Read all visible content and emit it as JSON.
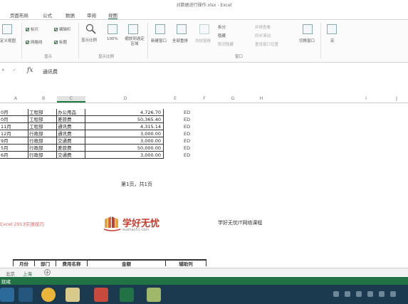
{
  "window": {
    "title": "对数据进行操作.xlsx - Excel"
  },
  "tabs": [
    "页面布局",
    "公式",
    "数据",
    "审阅",
    "视图"
  ],
  "ribbon": {
    "workbook_views": {
      "label": "定义视图"
    },
    "show": {
      "ruler": "标尺",
      "formula_bar": "编辑栏",
      "gridlines": "网格线",
      "headings": "标题",
      "group_label": "显示"
    },
    "zoom": {
      "zoom": "显示比例",
      "hundred": "100%",
      "to_selection": "缩放到选定区域",
      "group_label": "显示比例"
    },
    "window": {
      "new_window": "新建窗口",
      "arrange_all": "全部重排",
      "freeze_panes": "冻结窗格",
      "split": "拆分",
      "hide": "隐藏",
      "unhide": "取消隐藏",
      "side_by_side": "并排查看",
      "sync_scroll": "同步滚动",
      "reset_position": "重设窗口位置",
      "switch_windows": "切换窗口",
      "macros": "宏",
      "group_label": "窗口"
    }
  },
  "formula_bar": {
    "content": "通讯费"
  },
  "columns": [
    "A",
    "B",
    "C",
    "D",
    "E",
    "F",
    "G",
    "H",
    "I",
    "J"
  ],
  "rows": [
    {
      "month": "0月",
      "dept": "工程部",
      "item": "办公用品",
      "amount": "4,726.70",
      "sig": "ED"
    },
    {
      "month": "0月",
      "dept": "工程部",
      "item": "差旅费",
      "amount": "50,365.40",
      "sig": "ED"
    },
    {
      "month": "11月",
      "dept": "工程部",
      "item": "通讯费",
      "amount": "4,315.14",
      "sig": "ED"
    },
    {
      "month": "12月",
      "dept": "行政部",
      "item": "通讯费",
      "amount": "3,000.00",
      "sig": "ED"
    },
    {
      "month": "9月",
      "dept": "行政部",
      "item": "交通费",
      "amount": "3,000.00",
      "sig": "ED"
    },
    {
      "month": "5月",
      "dept": "行政部",
      "item": "差旅费",
      "amount": "50,000.00",
      "sig": "ED"
    },
    {
      "month": "6月",
      "dept": "行政部",
      "item": "交通费",
      "amount": "3,000.00",
      "sig": "ED"
    }
  ],
  "page_footer": "第1页，共1页",
  "watermark": {
    "left": "Excel 2013实操技巧",
    "logo_name": "学好无忧",
    "logo_sub": "xuehao51.com",
    "right": "学好无忧IT网络课程"
  },
  "bottom_header": [
    "月份",
    "部门",
    "费用名称",
    "金额",
    "辅助列"
  ],
  "sheets": [
    "北京",
    "上海"
  ],
  "status": "就绪",
  "colors": {
    "excel_green": "#217346",
    "taskbar": "#1c3a4f",
    "logo_red": "#c83b2e"
  }
}
